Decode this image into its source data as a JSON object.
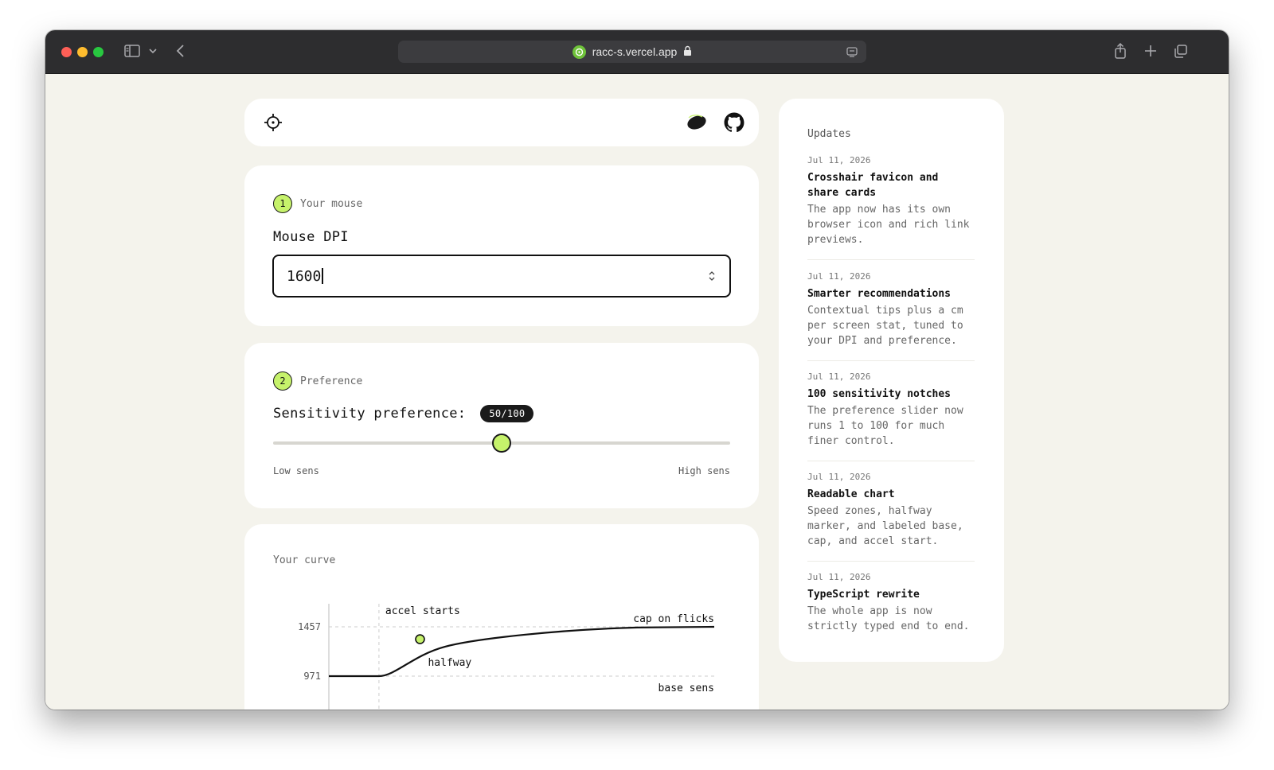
{
  "browser": {
    "url": "racc-s.vercel.app"
  },
  "step1": {
    "number": "1",
    "label": "Your mouse",
    "field_title": "Mouse DPI",
    "dpi_value": "1600"
  },
  "step2": {
    "number": "2",
    "label": "Preference",
    "field_title": "Sensitivity preference:",
    "badge": "50/100",
    "slider_value": 50,
    "slider_max": 100,
    "low_label": "Low sens",
    "high_label": "High sens"
  },
  "curve": {
    "title": "Your curve"
  },
  "chart_data": {
    "type": "line",
    "title": "",
    "yticks": [
      "1457",
      "971"
    ],
    "annotations": {
      "accel_start": "accel starts",
      "cap": "cap on flicks",
      "halfway": "halfway",
      "base": "base sens"
    },
    "base_value": 971,
    "cap_value": 1457,
    "points": [
      [
        0,
        971
      ],
      [
        0.13,
        971
      ],
      [
        0.22,
        1100
      ],
      [
        0.3,
        1260
      ],
      [
        0.45,
        1380
      ],
      [
        0.6,
        1430
      ],
      [
        0.8,
        1450
      ],
      [
        1,
        1457
      ]
    ]
  },
  "updates": {
    "heading": "Updates",
    "items": [
      {
        "date": "Jul 11, 2026",
        "title": "Crosshair favicon and share cards",
        "desc": "The app now has its own browser icon and rich link previews."
      },
      {
        "date": "Jul 11, 2026",
        "title": "Smarter recommendations",
        "desc": "Contextual tips plus a cm per screen stat, tuned to your DPI and preference."
      },
      {
        "date": "Jul 11, 2026",
        "title": "100 sensitivity notches",
        "desc": "The preference slider now runs 1 to 100 for much finer control."
      },
      {
        "date": "Jul 11, 2026",
        "title": "Readable chart",
        "desc": "Speed zones, halfway marker, and labeled base, cap, and accel start."
      },
      {
        "date": "Jul 11, 2026",
        "title": "TypeScript rewrite",
        "desc": "The whole app is now strictly typed end to end."
      }
    ]
  },
  "colors": {
    "accent": "#c6f26b",
    "page_bg": "#f4f3ec",
    "dark": "#1a1a1a"
  }
}
